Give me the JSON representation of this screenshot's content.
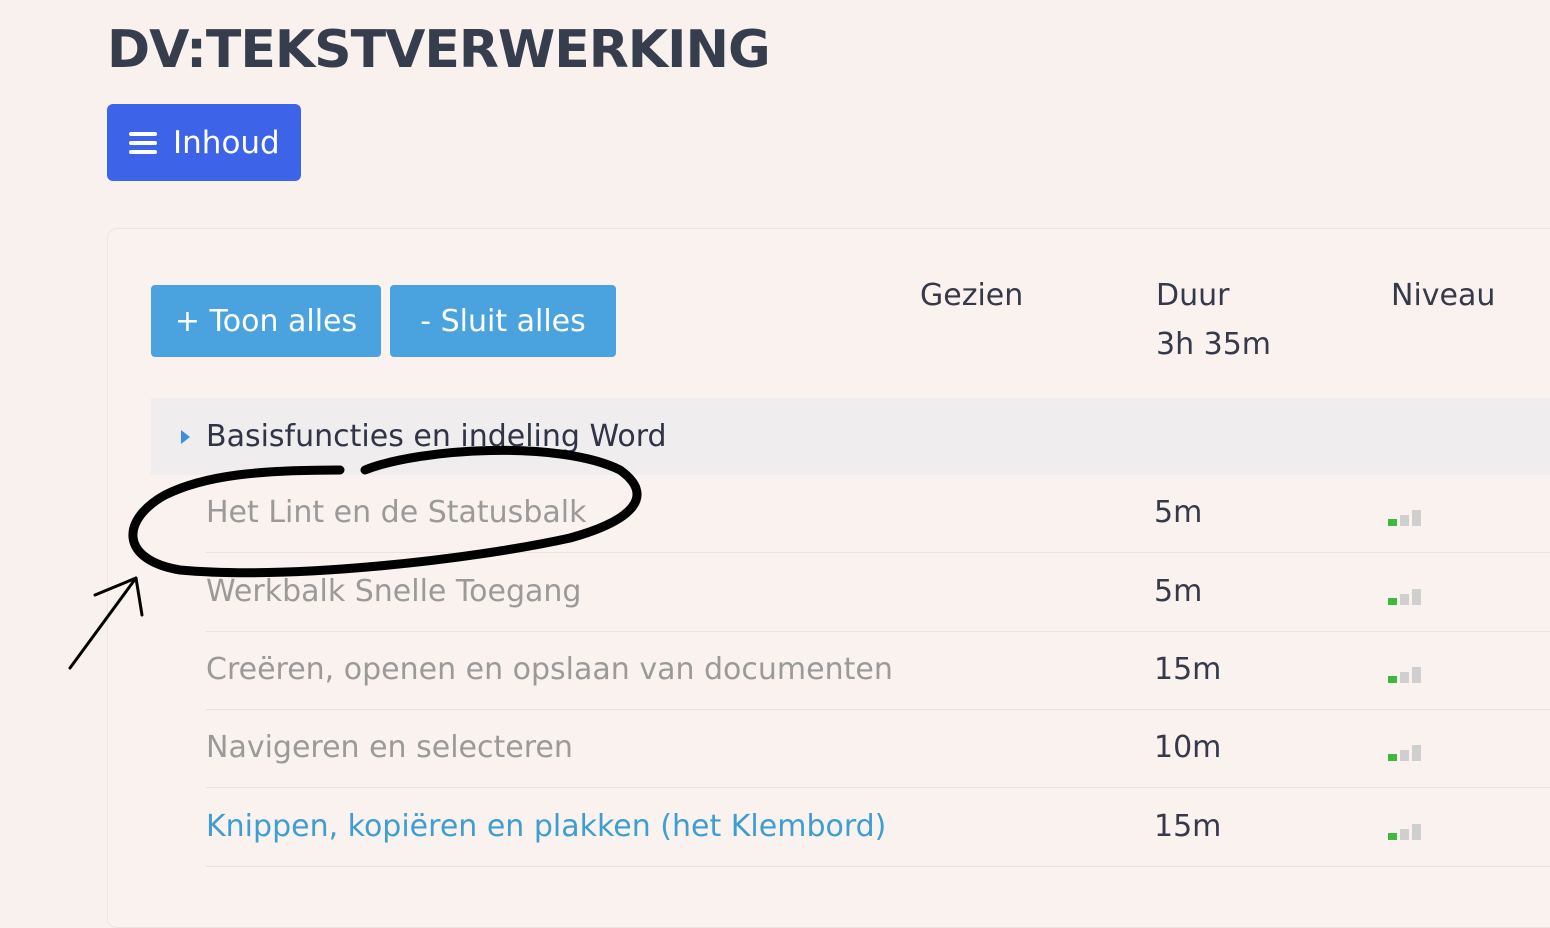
{
  "header": {
    "title": "DV:TEKSTVERWERKING",
    "toc_label": "Inhoud"
  },
  "actions": {
    "expand_all": "+ Toon alles",
    "collapse_all": "- Sluit alles"
  },
  "columns": {
    "seen": "Gezien",
    "duration": "Duur",
    "level": "Niveau",
    "total_duration": "3h 35m"
  },
  "section": {
    "label": "Basisfuncties en indeling Word",
    "expanded": false
  },
  "lessons": [
    {
      "title": "Het Lint en de Statusbalk",
      "duration": "5m",
      "level": 1,
      "is_link": false
    },
    {
      "title": "Werkbalk Snelle Toegang",
      "duration": "5m",
      "level": 1,
      "is_link": false
    },
    {
      "title": "Creëren, openen en opslaan van documenten",
      "duration": "15m",
      "level": 1,
      "is_link": false
    },
    {
      "title": "Navigeren en selecteren",
      "duration": "10m",
      "level": 1,
      "is_link": false
    },
    {
      "title": "Knippen, kopiëren en plakken (het Klembord)",
      "duration": "15m",
      "level": 1,
      "is_link": true
    }
  ],
  "colors": {
    "primary_button": "#3d64e8",
    "secondary_button": "#4aa3de",
    "link": "#3f9ed1",
    "muted_text": "#9a9a9a",
    "level_active": "#3fb840",
    "level_inactive": "#cfcfcf",
    "annotation": "#000000"
  },
  "icons": {
    "toc": "hamburger-icon",
    "section_toggle": "caret-right-icon",
    "level": "signal-bars-icon"
  }
}
